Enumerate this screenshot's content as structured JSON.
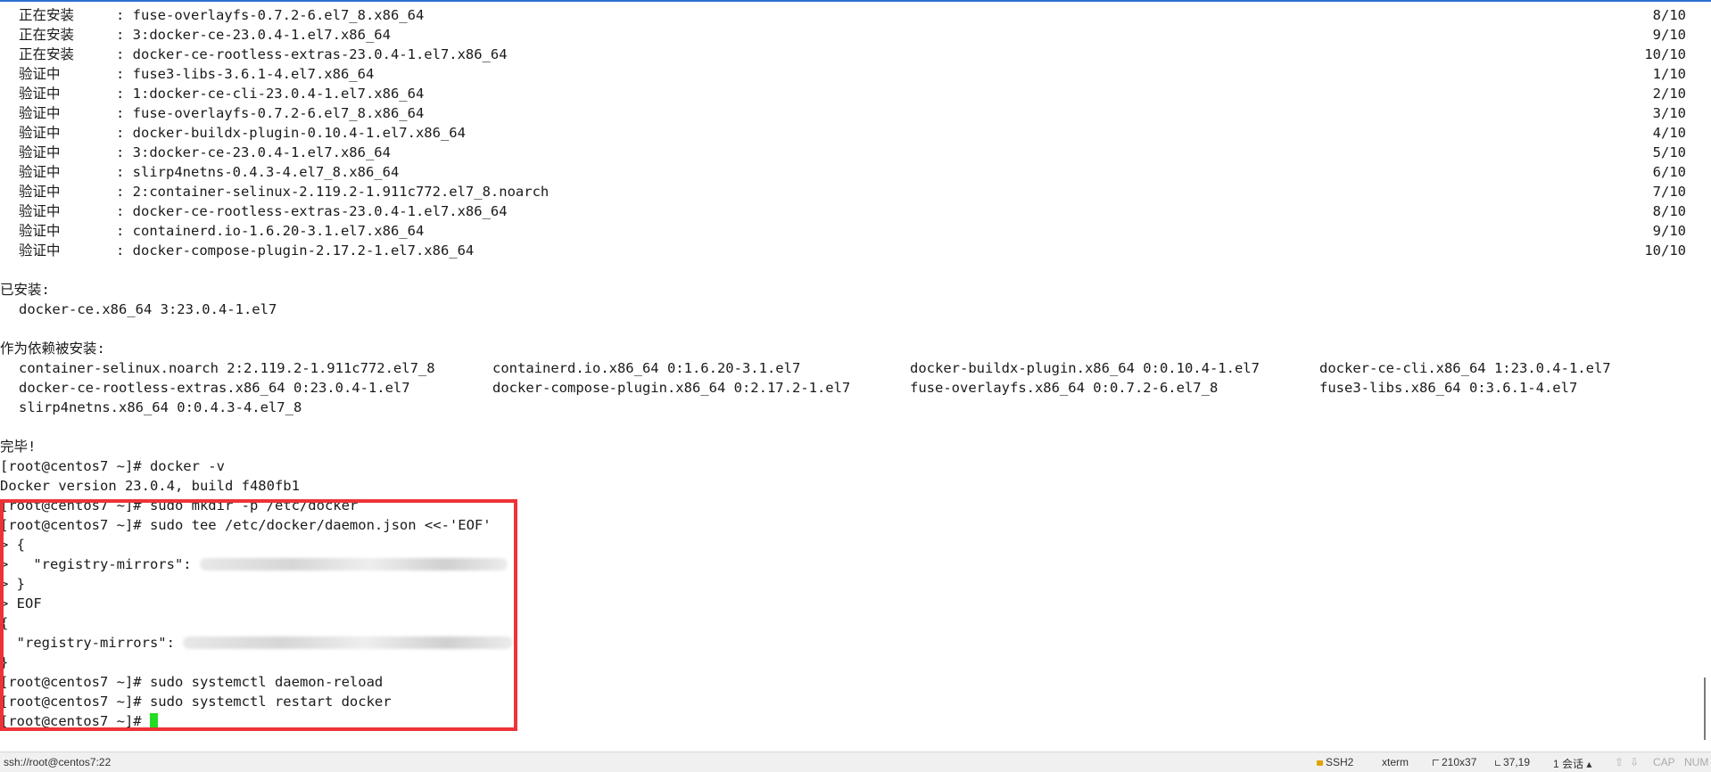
{
  "installing": [
    {
      "status": "正在安装",
      "pkg": ": fuse-overlayfs-0.7.2-6.el7_8.x86_64",
      "count": "8/10"
    },
    {
      "status": "正在安装",
      "pkg": ": 3:docker-ce-23.0.4-1.el7.x86_64",
      "count": "9/10"
    },
    {
      "status": "正在安装",
      "pkg": ": docker-ce-rootless-extras-23.0.4-1.el7.x86_64",
      "count": "10/10"
    }
  ],
  "verifying": [
    {
      "status": "验证中",
      "pkg": ": fuse3-libs-3.6.1-4.el7.x86_64",
      "count": "1/10"
    },
    {
      "status": "验证中",
      "pkg": ": 1:docker-ce-cli-23.0.4-1.el7.x86_64",
      "count": "2/10"
    },
    {
      "status": "验证中",
      "pkg": ": fuse-overlayfs-0.7.2-6.el7_8.x86_64",
      "count": "3/10"
    },
    {
      "status": "验证中",
      "pkg": ": docker-buildx-plugin-0.10.4-1.el7.x86_64",
      "count": "4/10"
    },
    {
      "status": "验证中",
      "pkg": ": 3:docker-ce-23.0.4-1.el7.x86_64",
      "count": "5/10"
    },
    {
      "status": "验证中",
      "pkg": ": slirp4netns-0.4.3-4.el7_8.x86_64",
      "count": "6/10"
    },
    {
      "status": "验证中",
      "pkg": ": 2:container-selinux-2.119.2-1.911c772.el7_8.noarch",
      "count": "7/10"
    },
    {
      "status": "验证中",
      "pkg": ": docker-ce-rootless-extras-23.0.4-1.el7.x86_64",
      "count": "8/10"
    },
    {
      "status": "验证中",
      "pkg": ": containerd.io-1.6.20-3.1.el7.x86_64",
      "count": "9/10"
    },
    {
      "status": "验证中",
      "pkg": ": docker-compose-plugin-2.17.2-1.el7.x86_64",
      "count": "10/10"
    }
  ],
  "installed": {
    "heading": "已安装:",
    "item": "docker-ce.x86_64 3:23.0.4-1.el7"
  },
  "deps": {
    "heading": "作为依赖被安装:",
    "rows": [
      [
        "container-selinux.noarch 2:2.119.2-1.911c772.el7_8",
        "containerd.io.x86_64 0:1.6.20-3.1.el7",
        "docker-buildx-plugin.x86_64 0:0.10.4-1.el7",
        "docker-ce-cli.x86_64 1:23.0.4-1.el7"
      ],
      [
        "docker-ce-rootless-extras.x86_64 0:23.0.4-1.el7",
        "docker-compose-plugin.x86_64 0:2.17.2-1.el7",
        "fuse-overlayfs.x86_64 0:0.7.2-6.el7_8",
        "fuse3-libs.x86_64 0:3.6.1-4.el7"
      ],
      [
        "slirp4netns.x86_64 0:0.4.3-4.el7_8"
      ]
    ]
  },
  "done": "完毕!",
  "session": {
    "cmd_version": "[root@centos7 ~]# docker -v",
    "out_version": "Docker version 23.0.4, build f480fb1",
    "cmd_mkdir": "[root@centos7 ~]# sudo mkdir -p /etc/docker",
    "cmd_tee": "[root@centos7 ~]# sudo tee /etc/docker/daemon.json <<-'EOF'",
    "heredoc_open": "> {",
    "heredoc_key": ">   \"registry-mirrors\": ",
    "heredoc_close": "> }",
    "heredoc_eof": "> EOF",
    "echo_open": "{",
    "echo_key": "  \"registry-mirrors\": ",
    "echo_close": "}",
    "cmd_reload": "[root@centos7 ~]# sudo systemctl daemon-reload",
    "cmd_restart": "[root@centos7 ~]# sudo systemctl restart docker",
    "prompt": "[root@centos7 ~]# "
  },
  "statusbar": {
    "connection": "ssh://root@centos7:22",
    "protocol": "SSH2",
    "term": "xterm",
    "size": "210x37",
    "cursor_pos": "37,19",
    "sessions": "1 会话",
    "cap": "CAP",
    "num": "NUM"
  },
  "colors": {
    "highlight_border": "#ee3338",
    "cursor": "#22dd22",
    "accent_line": "#2f6fd1"
  }
}
